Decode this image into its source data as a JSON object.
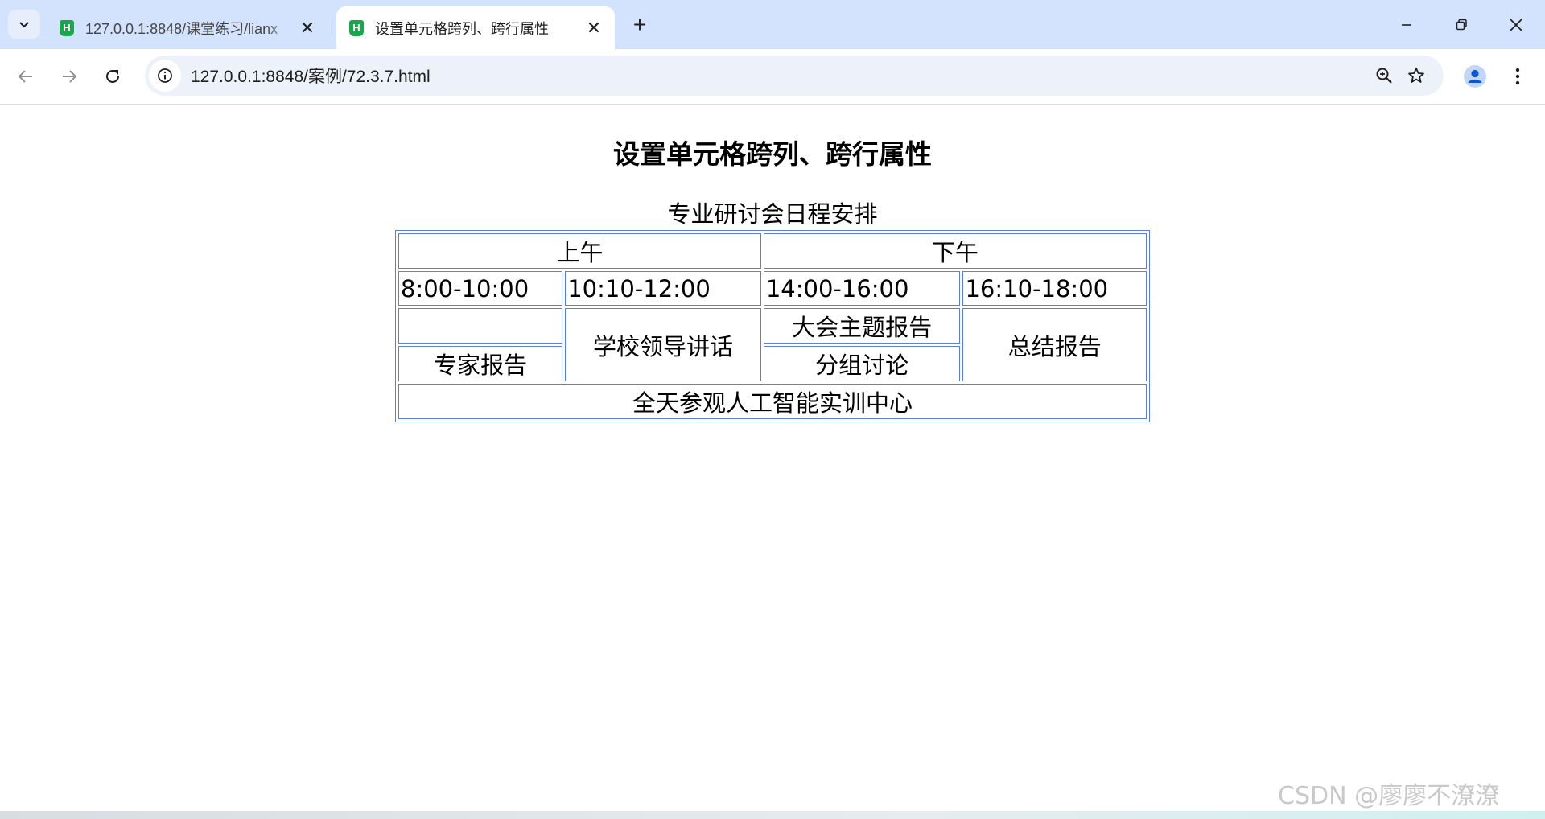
{
  "browser": {
    "tabs": [
      {
        "title": "127.0.0.1:8848/课堂练习/lianx",
        "active": false,
        "favicon_letter": "H"
      },
      {
        "title": "设置单元格跨列、跨行属性",
        "active": true,
        "favicon_letter": "H"
      }
    ],
    "new_tab_label": "+",
    "url": "127.0.0.1:8848/案例/72.3.7.html",
    "icons": {
      "tab_search": "chevron-down-icon",
      "back": "arrow-left-icon",
      "forward": "arrow-right-icon",
      "reload": "reload-icon",
      "site_info": "info-icon",
      "zoom": "zoom-icon",
      "bookmark": "star-icon",
      "profile": "person-icon",
      "menu": "kebab-menu-icon",
      "minimize": "minimize-icon",
      "restore": "restore-icon",
      "close": "close-icon"
    },
    "colors": {
      "tabstrip": "#d3e3fd",
      "omnibox": "#edf2fa",
      "favicon": "#1aa64a",
      "profile": "#0b57d0"
    }
  },
  "page": {
    "heading": "设置单元格跨列、跨行属性",
    "table": {
      "caption": "专业研讨会日程安排",
      "morning": "上午",
      "afternoon": "下午",
      "slots": [
        "8:00-10:00",
        "10:10-12:00",
        "14:00-16:00",
        "16:10-18:00"
      ],
      "expert_report": "专家报告",
      "leader_speech": "学校领导讲话",
      "keynote": "大会主题报告",
      "group_discussion": "分组讨论",
      "summary_report": "总结报告",
      "full_day": "全天参观人工智能实训中心",
      "border_color": "#5b7de0"
    }
  },
  "watermark": "CSDN @廖廖不潦潦"
}
